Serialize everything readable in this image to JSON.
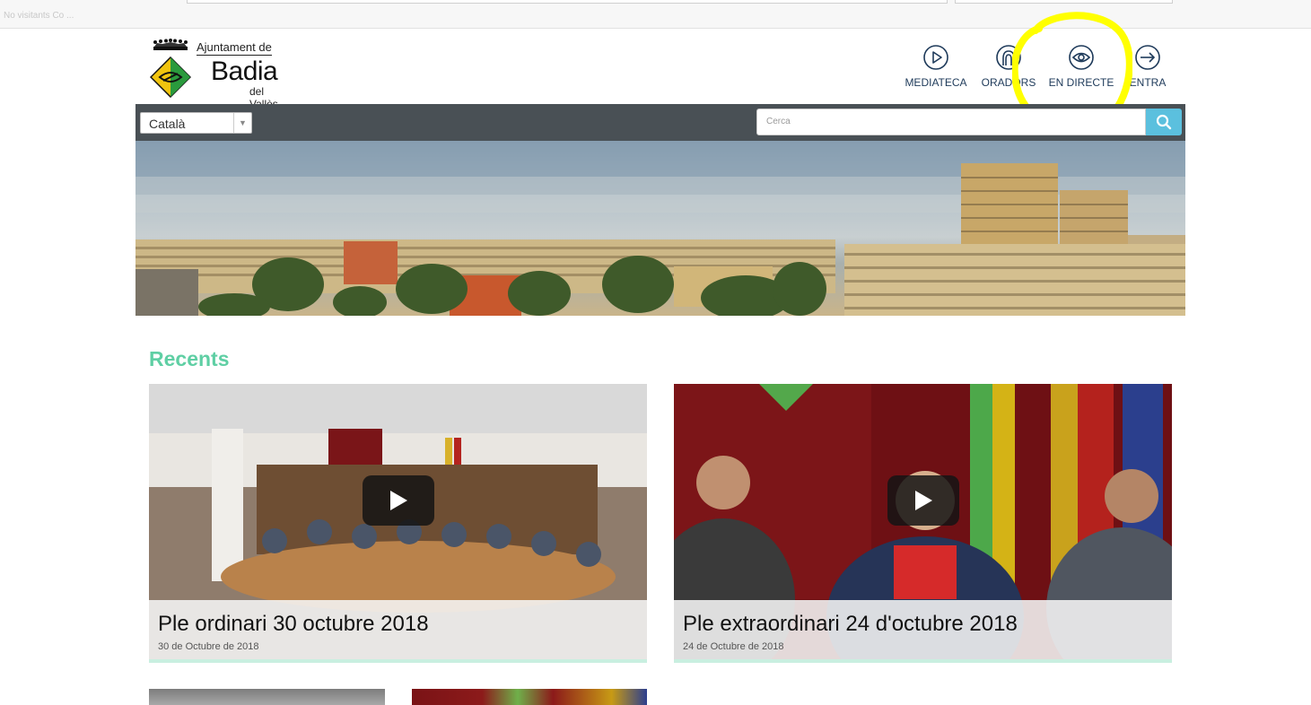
{
  "browser": {
    "faded_text": "No visitants   Co ..."
  },
  "logo": {
    "line1": "Ajuntament de",
    "line2": "Badia",
    "line3": "del Vallès"
  },
  "nav": {
    "mediateca": "MEDIATECA",
    "oradors": "ORADORS",
    "directe": "EN DIRECTE",
    "entra": "ENTRA"
  },
  "toolbar": {
    "language": "Català",
    "search_placeholder": "Cerca"
  },
  "recents": {
    "title": "Recents",
    "items": [
      {
        "title": "Ple ordinari 30 octubre 2018",
        "date": "30 de Octubre de 2018"
      },
      {
        "title": "Ple extraordinari 24 d'octubre 2018",
        "date": "24 de Octubre de 2018"
      }
    ]
  },
  "colors": {
    "accent_green": "#5fcfa4",
    "toolbar_bg": "#495055",
    "search_button": "#5bc0de",
    "nav_text": "#1e3a5a",
    "highlight": "#ffff00"
  }
}
